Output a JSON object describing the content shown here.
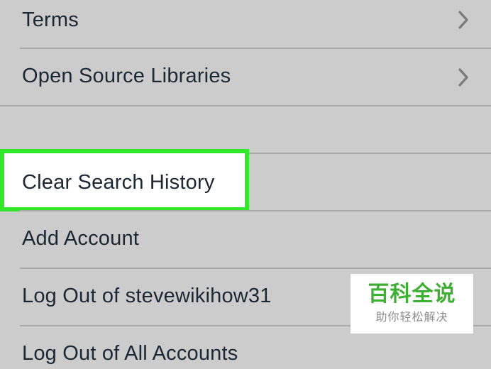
{
  "settings_list": {
    "items": [
      {
        "label": "Terms",
        "has_chevron": true
      },
      {
        "label": "Open Source Libraries",
        "has_chevron": true
      },
      {
        "label": "Clear Search History",
        "highlighted": true,
        "highlight_color": "#33e82a"
      },
      {
        "label": "Add Account"
      },
      {
        "label": "Log Out of stevewikihow31"
      },
      {
        "label": "Log Out of All Accounts"
      }
    ]
  },
  "icons": {
    "chevron": "chevron-right-icon"
  },
  "watermark": {
    "title": "百科全说",
    "subtitle": "助你轻松解决",
    "title_color": "#3db033"
  },
  "colors": {
    "background": "#cccccc",
    "text": "#1b2733",
    "separator": "#a9a9a9",
    "chevron": "#7a7a7a"
  }
}
